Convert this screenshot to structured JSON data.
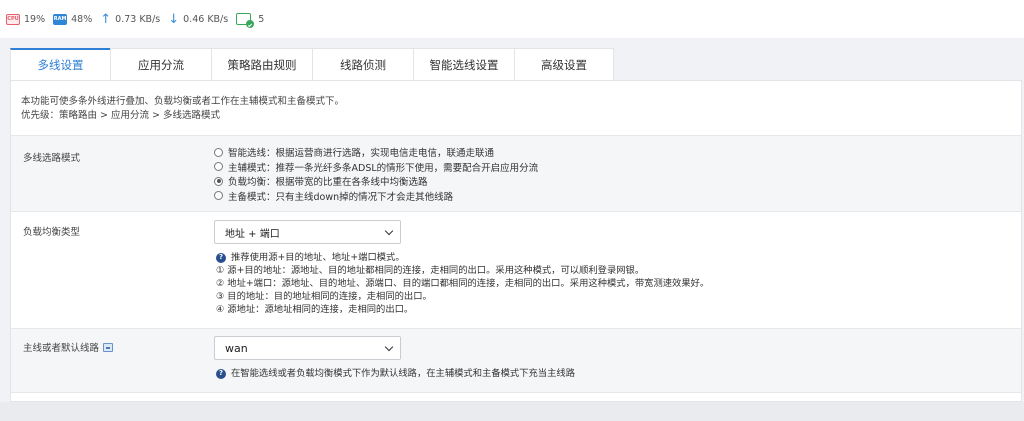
{
  "status": {
    "cpu_label": "CPU",
    "cpu": "19%",
    "ram_label": "RAM",
    "ram": "48%",
    "upload": "0.73 KB/s",
    "download": "0.46 KB/s",
    "connections": "5"
  },
  "tabs": [
    {
      "label": "多线设置",
      "active": true
    },
    {
      "label": "应用分流"
    },
    {
      "label": "策略路由规则"
    },
    {
      "label": "线路侦测"
    },
    {
      "label": "智能选线设置"
    },
    {
      "label": "高级设置"
    }
  ],
  "description": {
    "line1": "本功能可使多条外线进行叠加、负载均衡或者工作在主辅模式和主备模式下。",
    "line2": "优先级：策略路由 > 应用分流 > 多线选路模式"
  },
  "mode": {
    "label": "多线选路模式",
    "options": [
      "智能选线：根据运营商进行选路，实现电信走电信，联通走联通",
      "主辅模式：推荐一条光纤多条ADSL的情形下使用，需要配合开启应用分流",
      "负载均衡：根据带宽的比重在各条线中均衡选路",
      "主备模式：只有主线down掉的情况下才会走其他线路"
    ],
    "selected_index": 2
  },
  "balance": {
    "label": "负载均衡类型",
    "selected": "地址 + 端口",
    "help": [
      "推荐使用源+目的地址、地址+端口模式。",
      "① 源+目的地址：源地址、目的地址都相同的连接，走相同的出口。采用这种模式，可以顺利登录网银。",
      "② 地址+端口：源地址、目的地址、源端口、目的端口都相同的连接，走相同的出口。采用这种模式，带宽测速效果好。",
      "③ 目的地址：目的地址相同的连接，走相同的出口。",
      "④ 源地址：源地址相同的连接，走相同的出口。"
    ]
  },
  "default_line": {
    "label": "主线或者默认线路",
    "selected": "wan",
    "help": "在智能选线或者负载均衡模式下作为默认线路，在主辅模式和主备模式下充当主线路"
  },
  "colors": {
    "accent": "#2f7fd6",
    "help_icon": "#2a4f8f",
    "cpu": "#e6606d",
    "ram": "#2f86d4",
    "connection": "#3aa85b"
  }
}
